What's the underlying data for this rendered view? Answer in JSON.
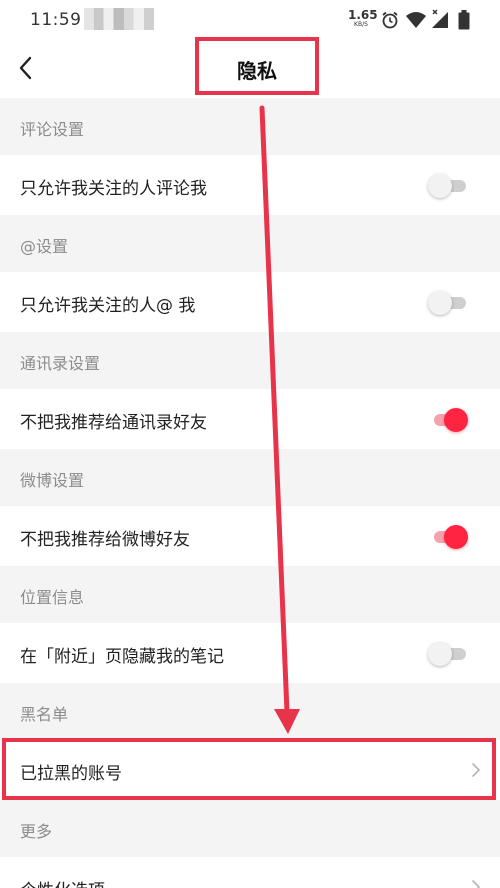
{
  "status_bar": {
    "time": "11:59",
    "net_speed_value": "1.65",
    "net_speed_unit": "KB/S",
    "icons": [
      "alarm-icon",
      "wifi-icon",
      "signal-icon",
      "battery-icon"
    ]
  },
  "navbar": {
    "back_icon": "chevron-left-icon",
    "title": "隐私"
  },
  "sections": [
    {
      "header": "评论设置",
      "row": {
        "label": "只允许我关注的人评论我",
        "control": "toggle",
        "checked": false
      }
    },
    {
      "header": "@设置",
      "row": {
        "label": "只允许我关注的人@ 我",
        "control": "toggle",
        "checked": false
      }
    },
    {
      "header": "通讯录设置",
      "row": {
        "label": "不把我推荐给通讯录好友",
        "control": "toggle",
        "checked": true
      }
    },
    {
      "header": "微博设置",
      "row": {
        "label": "不把我推荐给微博好友",
        "control": "toggle",
        "checked": true
      }
    },
    {
      "header": "位置信息",
      "row": {
        "label": "在「附近」页隐藏我的笔记",
        "control": "toggle",
        "checked": false
      }
    },
    {
      "header": "黑名单",
      "row": {
        "label": "已拉黑的账号",
        "control": "chevron"
      }
    },
    {
      "header": "更多",
      "row": {
        "label": "个性化选项",
        "control": "chevron"
      }
    }
  ],
  "colors": {
    "accent": "#ff2442",
    "annotation": "#e8344a",
    "section_bg": "#f4f4f4",
    "toggle_off_track": "#cfcfcf"
  }
}
